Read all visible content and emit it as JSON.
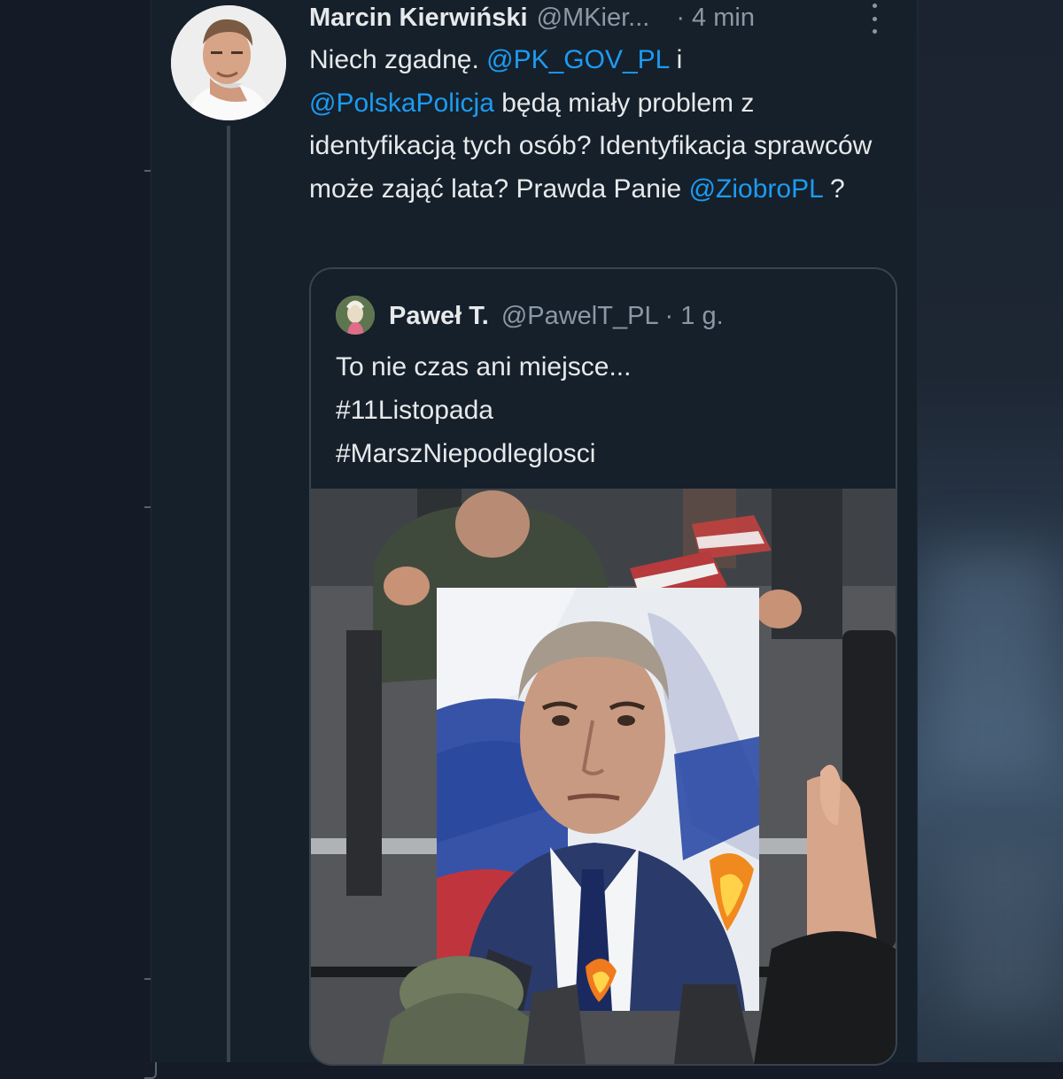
{
  "tweet": {
    "author_name": "Marcin Kierwiński",
    "author_handle": "@MKier...",
    "timestamp": "· 4 min",
    "text_segments": [
      {
        "text": "Niech zgadnę. "
      },
      {
        "text": "@PK_GOV_PL",
        "mention": true
      },
      {
        "text": " i "
      },
      {
        "text": "@PolskaPolicja",
        "mention": true
      },
      {
        "text": " będą miały problem z identyfikacją tych osób? Identyfikacja sprawców może zająć lata? Prawda Panie "
      },
      {
        "text": "@ZiobroPL",
        "mention": true
      },
      {
        "text": " ?"
      }
    ]
  },
  "quoted_tweet": {
    "author_name": "Paweł T.",
    "author_handle": "@PawelT_PL · 1 g.",
    "lines": [
      "To nie czas ani miejsce...",
      "#11Listopada",
      "#MarszNiepodleglosci"
    ]
  },
  "colors": {
    "background": "#15202b",
    "text": "#e7e9ea",
    "secondary": "#8b98a5",
    "link": "#1d9bf0",
    "border": "#38444d"
  },
  "icons": [
    "more-options-icon"
  ]
}
